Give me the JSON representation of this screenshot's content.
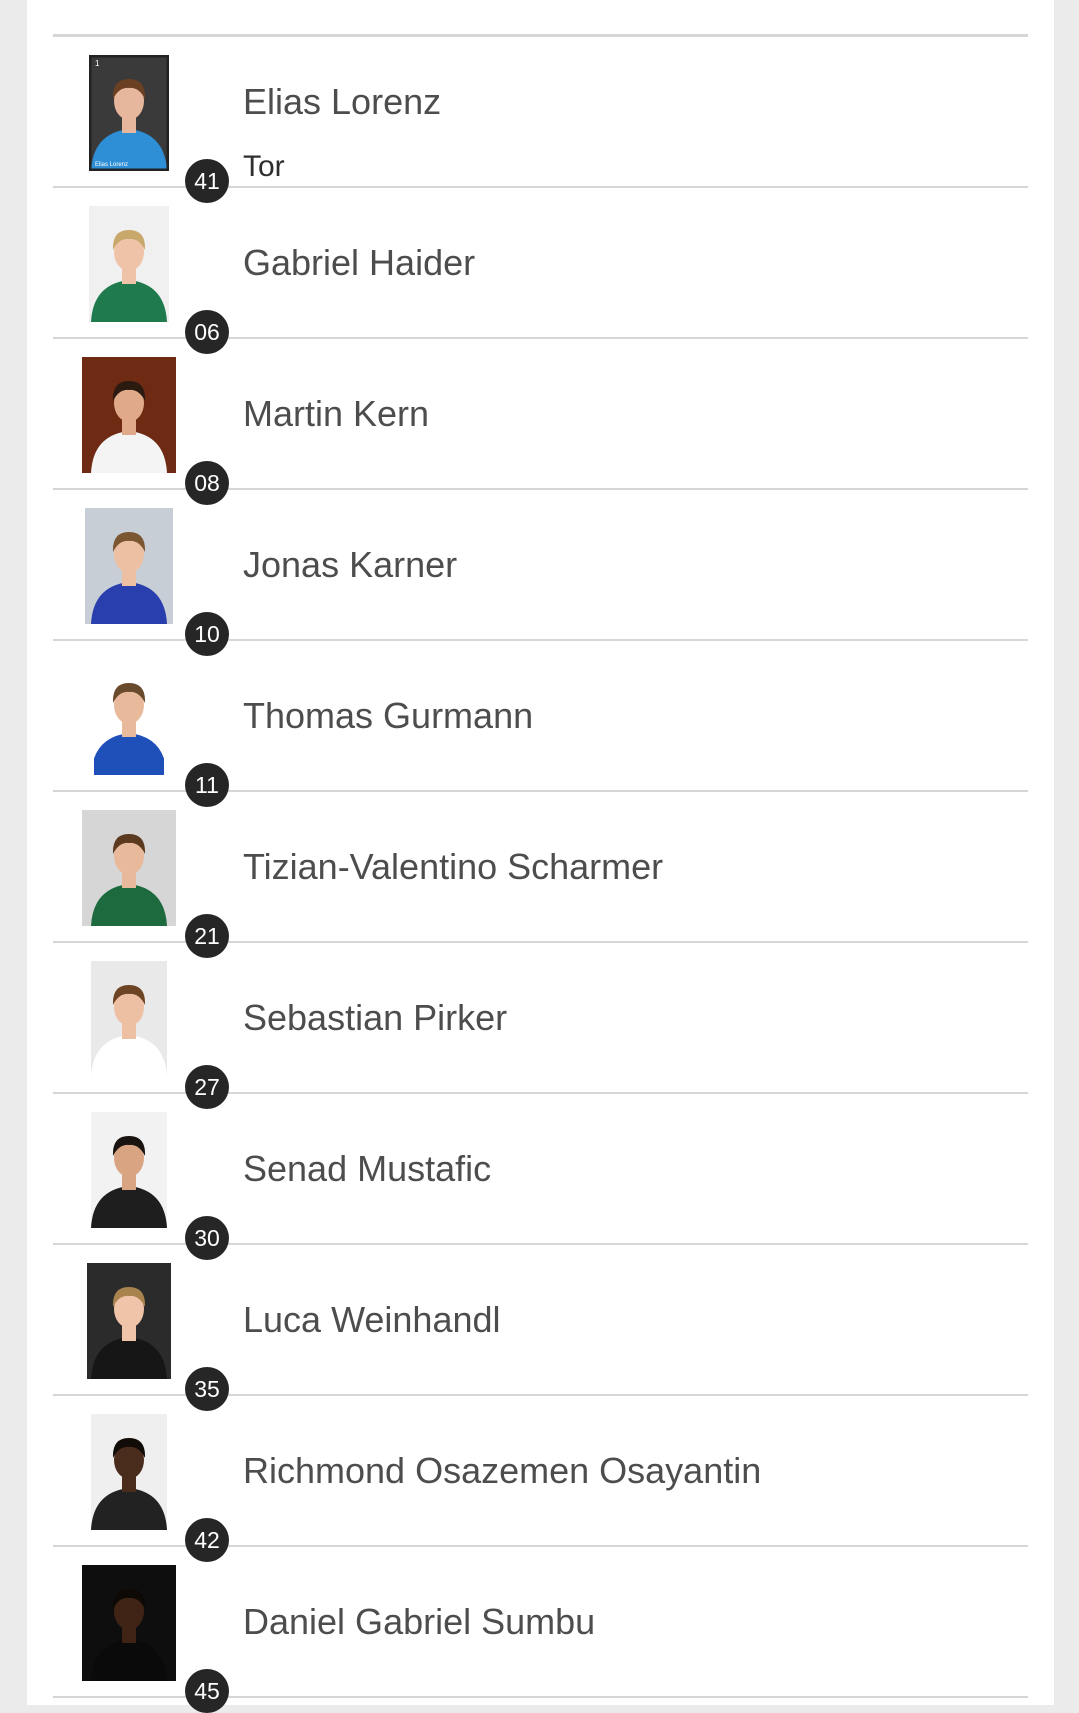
{
  "players": [
    {
      "name": "Elias Lorenz",
      "number": "41",
      "position": "Tor",
      "photo": {
        "bg": "#3a3a3a",
        "shirt": "#2e8fd6",
        "hair": "#6b3f22",
        "skin": "#e6b79c",
        "border": "#222222",
        "caption": "Elias Lorenz",
        "cardnum": "1"
      }
    },
    {
      "name": "Gabriel Haider",
      "number": "06",
      "photo": {
        "bg": "#f0f0f0",
        "shirt": "#1f7a4d",
        "hair": "#c9a86b",
        "skin": "#efc3a8"
      }
    },
    {
      "name": "Martin Kern",
      "number": "08",
      "photo": {
        "bg": "#6e2a12",
        "shirt": "#f4f4f4",
        "hair": "#2a1a10",
        "skin": "#e0aa8a"
      }
    },
    {
      "name": "Jonas Karner",
      "number": "10",
      "photo": {
        "bg": "#c8ced6",
        "shirt": "#2a3fae",
        "hair": "#7a5632",
        "skin": "#edc0a4"
      }
    },
    {
      "name": "Thomas Gurmann",
      "number": "11",
      "photo": {
        "bg": "#ffffff",
        "shirt": "#1f4fb8",
        "hair": "#6a4a2c",
        "skin": "#e9b99c"
      }
    },
    {
      "name": "Tizian-Valentino Scharmer",
      "number": "21",
      "photo": {
        "bg": "#d6d6d6",
        "shirt": "#1d6a3f",
        "hair": "#5b3a20",
        "skin": "#e9b99c"
      }
    },
    {
      "name": "Sebastian Pirker",
      "number": "27",
      "photo": {
        "bg": "#e9e9e9",
        "shirt": "#ffffff",
        "hair": "#6d4524",
        "skin": "#edc0a4"
      }
    },
    {
      "name": "Senad Mustafic",
      "number": "30",
      "photo": {
        "bg": "#f2f2f2",
        "shirt": "#1e1e1e",
        "hair": "#1a1410",
        "skin": "#d9a482"
      }
    },
    {
      "name": "Luca Weinhandl",
      "number": "35",
      "photo": {
        "bg": "#2b2b2b",
        "shirt": "#161616",
        "hair": "#a8834e",
        "skin": "#f0c4a8"
      }
    },
    {
      "name": "Richmond Osazemen Osayantin",
      "number": "42",
      "photo": {
        "bg": "#efefef",
        "shirt": "#222222",
        "hair": "#120c08",
        "skin": "#4a2c1c"
      }
    },
    {
      "name": "Daniel Gabriel Sumbu",
      "number": "45",
      "photo": {
        "bg": "#0e0e0e",
        "shirt": "#0a0a0a",
        "hair": "#0d0905",
        "skin": "#3f2416"
      }
    }
  ]
}
